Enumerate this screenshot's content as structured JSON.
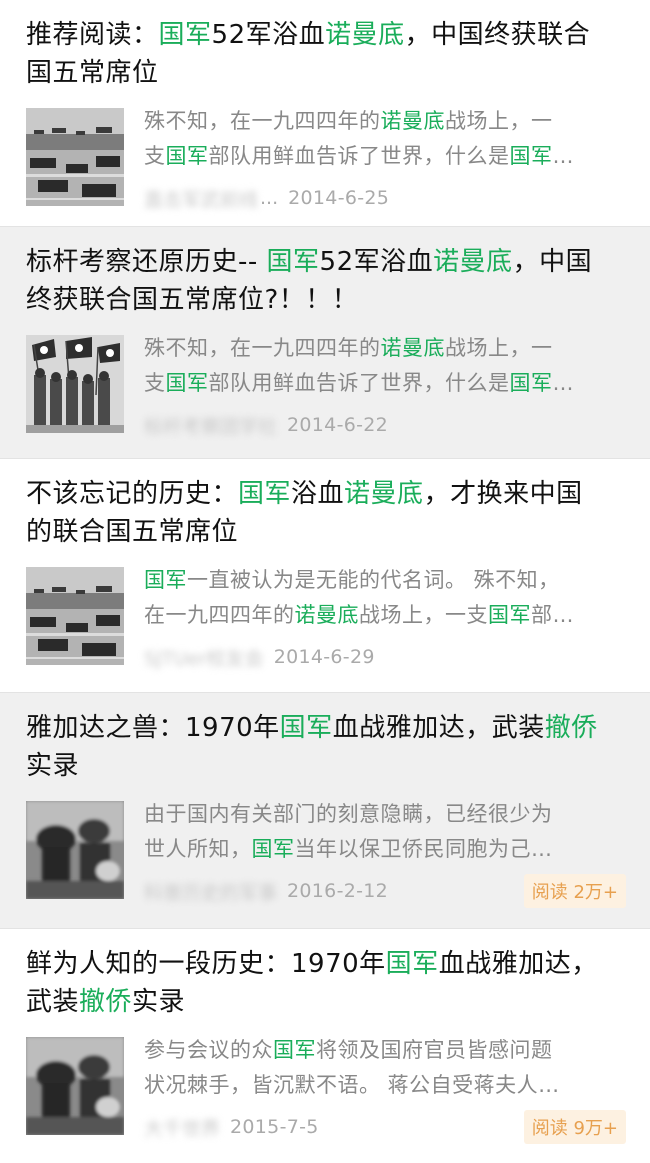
{
  "articles": [
    {
      "title": [
        [
          {
            "t": "推荐阅读：",
            "h": false
          },
          {
            "t": "国军",
            "h": true
          },
          {
            "t": "52军浴血",
            "h": false
          },
          {
            "t": "诺曼底",
            "h": true
          },
          {
            "t": "，中国终获联合",
            "h": false
          }
        ],
        [
          {
            "t": "国五常席位",
            "h": false
          }
        ]
      ],
      "desc": [
        [
          {
            "t": "殊不知，在一九四四年的",
            "h": false
          },
          {
            "t": "诺曼底",
            "h": true
          },
          {
            "t": "战场上，一",
            "h": false
          }
        ],
        [
          {
            "t": "支",
            "h": false
          },
          {
            "t": "国军",
            "h": true
          },
          {
            "t": "部队用鲜血告诉了世界，什么是",
            "h": false
          },
          {
            "t": "国军",
            "h": true
          },
          {
            "t": "…",
            "h": false
          }
        ]
      ],
      "source": "直击军武前线",
      "date": "2014-6-25",
      "badge": "",
      "thumb": "beach-landing"
    },
    {
      "title": [
        [
          {
            "t": "标杆考察还原历史-- ",
            "h": false
          },
          {
            "t": "国军",
            "h": true
          },
          {
            "t": "52军浴血",
            "h": false
          },
          {
            "t": "诺曼底",
            "h": true
          },
          {
            "t": "，中国",
            "h": false
          }
        ],
        [
          {
            "t": "终获联合国五常席位?！！！",
            "h": false
          }
        ]
      ],
      "desc": [
        [
          {
            "t": "殊不知，在一九四四年的",
            "h": false
          },
          {
            "t": "诺曼底",
            "h": true
          },
          {
            "t": "战场上，一",
            "h": false
          }
        ],
        [
          {
            "t": "支",
            "h": false
          },
          {
            "t": "国军",
            "h": true
          },
          {
            "t": "部队用鲜血告诉了世界，什么是",
            "h": false
          },
          {
            "t": "国军",
            "h": true
          },
          {
            "t": "…",
            "h": false
          }
        ]
      ],
      "source": "标杆考察团学社",
      "date": "2014-6-22",
      "badge": "",
      "thumb": "soldiers-flags"
    },
    {
      "title": [
        [
          {
            "t": "不该忘记的历史：",
            "h": false
          },
          {
            "t": "国军",
            "h": true
          },
          {
            "t": "浴血",
            "h": false
          },
          {
            "t": "诺曼底",
            "h": true
          },
          {
            "t": "，才换来中国",
            "h": false
          }
        ],
        [
          {
            "t": "的联合国五常席位",
            "h": false
          }
        ]
      ],
      "desc": [
        [
          {
            "t": "国军",
            "h": true
          },
          {
            "t": "一直被认为是无能的代名词。 殊不知，",
            "h": false
          }
        ],
        [
          {
            "t": "在一九四四年的",
            "h": false
          },
          {
            "t": "诺曼底",
            "h": true
          },
          {
            "t": "战场上，一支",
            "h": false
          },
          {
            "t": "国军",
            "h": true
          },
          {
            "t": "部…",
            "h": false
          }
        ]
      ],
      "source": "SJTUer校友会",
      "date": "2014-6-29",
      "badge": "",
      "thumb": "beach-landing"
    },
    {
      "title": [
        [
          {
            "t": "雅加达之兽：1970年",
            "h": false
          },
          {
            "t": "国军",
            "h": true
          },
          {
            "t": "血战雅加达，武装",
            "h": false
          },
          {
            "t": "撤侨",
            "h": true
          }
        ],
        [
          {
            "t": "实录",
            "h": false
          }
        ]
      ],
      "desc": [
        [
          {
            "t": "由于国内有关部门的刻意隐瞒，已经很少为",
            "h": false
          }
        ],
        [
          {
            "t": "世人所知，",
            "h": false
          },
          {
            "t": "国军",
            "h": true
          },
          {
            "t": "当年以保卫侨民同胞为己…",
            "h": false
          }
        ]
      ],
      "source": "科普历史的军事",
      "date": "2016-2-12",
      "badge": "阅读 2万+",
      "thumb": "combat-blur"
    },
    {
      "title": [
        [
          {
            "t": "鲜为人知的一段历史：1970年",
            "h": false
          },
          {
            "t": "国军",
            "h": true
          },
          {
            "t": "血战雅加达，",
            "h": false
          }
        ],
        [
          {
            "t": "武装",
            "h": false
          },
          {
            "t": "撤侨",
            "h": true
          },
          {
            "t": "实录",
            "h": false
          }
        ]
      ],
      "desc": [
        [
          {
            "t": "参与会议的众",
            "h": false
          },
          {
            "t": "国军",
            "h": true
          },
          {
            "t": "将领及国府官员皆感问题",
            "h": false
          }
        ],
        [
          {
            "t": "状况棘手，皆沉默不语。 蒋公自受蒋夫人…",
            "h": false
          }
        ]
      ],
      "source": "大千世界",
      "date": "2015-7-5",
      "badge": "阅读 9万+",
      "thumb": "combat-blur"
    }
  ],
  "colors": {
    "highlight": "#1aad5a",
    "badge_bg": "#fdf1e1",
    "badge_text": "#e7a04f"
  }
}
